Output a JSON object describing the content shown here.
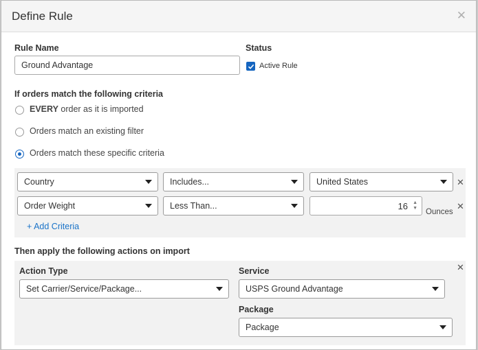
{
  "dialog": {
    "title": "Define Rule"
  },
  "rule_name": {
    "label": "Rule Name",
    "value": "Ground Advantage"
  },
  "status": {
    "label": "Status",
    "checkbox_label": "Active Rule",
    "checked": true
  },
  "criteria_section": {
    "heading": "If orders match the following criteria",
    "options": [
      {
        "bold": "EVERY",
        "text": " order as it is imported",
        "selected": false
      },
      {
        "bold": "",
        "text": "Orders match an existing filter",
        "selected": false
      },
      {
        "bold": "",
        "text": "Orders match these specific criteria",
        "selected": true
      }
    ],
    "rows": [
      {
        "field": "Country",
        "operator": "Includes...",
        "value": "United States"
      },
      {
        "field": "Order Weight",
        "operator": "Less Than...",
        "value": "16",
        "unit": "Ounces"
      }
    ],
    "add_criteria": "+ Add Criteria"
  },
  "actions_section": {
    "heading": "Then apply the following actions on import",
    "action_type_label": "Action Type",
    "action_type_value": "Set Carrier/Service/Package...",
    "service_label": "Service",
    "service_value": "USPS Ground Advantage",
    "package_label": "Package",
    "package_value": "Package"
  },
  "colors": {
    "accent": "#1565c0",
    "link": "#1a73c8",
    "panel": "#f2f2f2"
  },
  "icons": {
    "close": "close-icon",
    "remove": "remove-x-icon",
    "caret": "chevron-down-icon",
    "check": "check-icon"
  }
}
